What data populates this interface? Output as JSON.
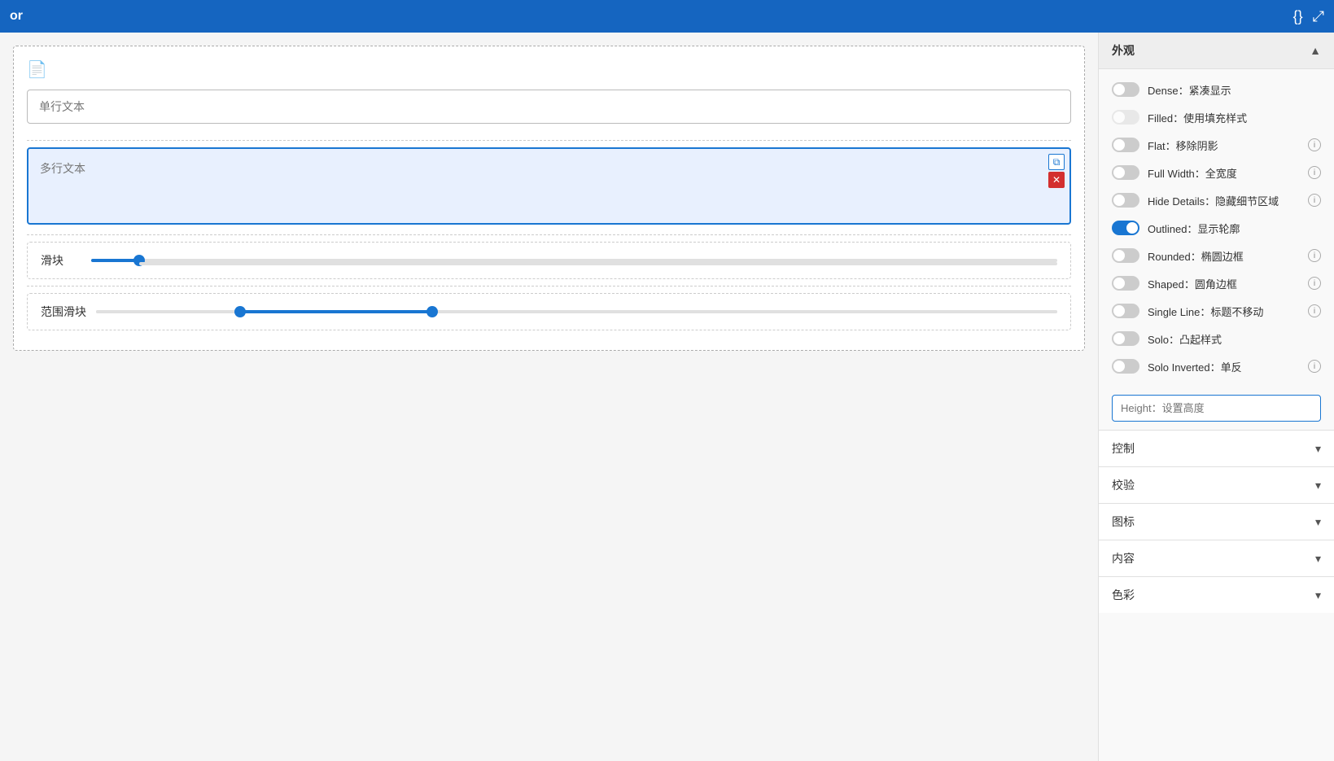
{
  "topbar": {
    "title": "or",
    "icon_code": "{}",
    "icon_expand": "⤢"
  },
  "left_panel": {
    "card_icon": "📄",
    "single_line_placeholder": "单行文本",
    "multiline_placeholder": "多行文本",
    "slider_label": "滑块",
    "range_label": "范围滑块",
    "slider_value": 5,
    "range_start": 15,
    "range_end": 35
  },
  "right_panel": {
    "appearance_title": "外观",
    "properties": [
      {
        "id": "dense",
        "label": "Dense：紧凑显示",
        "active": false,
        "disabled": false,
        "has_info": false
      },
      {
        "id": "filled",
        "label": "Filled：使用填充样式",
        "active": false,
        "disabled": true,
        "has_info": false
      },
      {
        "id": "flat",
        "label": "Flat：移除阴影",
        "active": false,
        "disabled": false,
        "has_info": true
      },
      {
        "id": "full_width",
        "label": "Full Width：全宽度",
        "active": false,
        "disabled": false,
        "has_info": true
      },
      {
        "id": "hide_details",
        "label": "Hide Details：隐藏细节区域",
        "active": false,
        "disabled": false,
        "has_info": true
      },
      {
        "id": "outlined",
        "label": "Outlined：显示轮廓",
        "active": true,
        "disabled": false,
        "has_info": false
      },
      {
        "id": "rounded",
        "label": "Rounded：椭圆边框",
        "active": false,
        "disabled": false,
        "has_info": true
      },
      {
        "id": "shaped",
        "label": "Shaped：圆角边框",
        "active": false,
        "disabled": false,
        "has_info": true
      },
      {
        "id": "single_line",
        "label": "Single Line：标题不移动",
        "active": false,
        "disabled": false,
        "has_info": true
      },
      {
        "id": "solo",
        "label": "Solo：凸起样式",
        "active": false,
        "disabled": false,
        "has_info": false
      },
      {
        "id": "solo_inverted",
        "label": "Solo Inverted：单反",
        "active": false,
        "disabled": false,
        "has_info": true
      }
    ],
    "height_placeholder": "Height：设置高度",
    "sections": [
      {
        "id": "control",
        "label": "控制"
      },
      {
        "id": "validate",
        "label": "校验"
      },
      {
        "id": "icon",
        "label": "图标"
      },
      {
        "id": "content",
        "label": "内容"
      },
      {
        "id": "color",
        "label": "色彩"
      }
    ]
  }
}
